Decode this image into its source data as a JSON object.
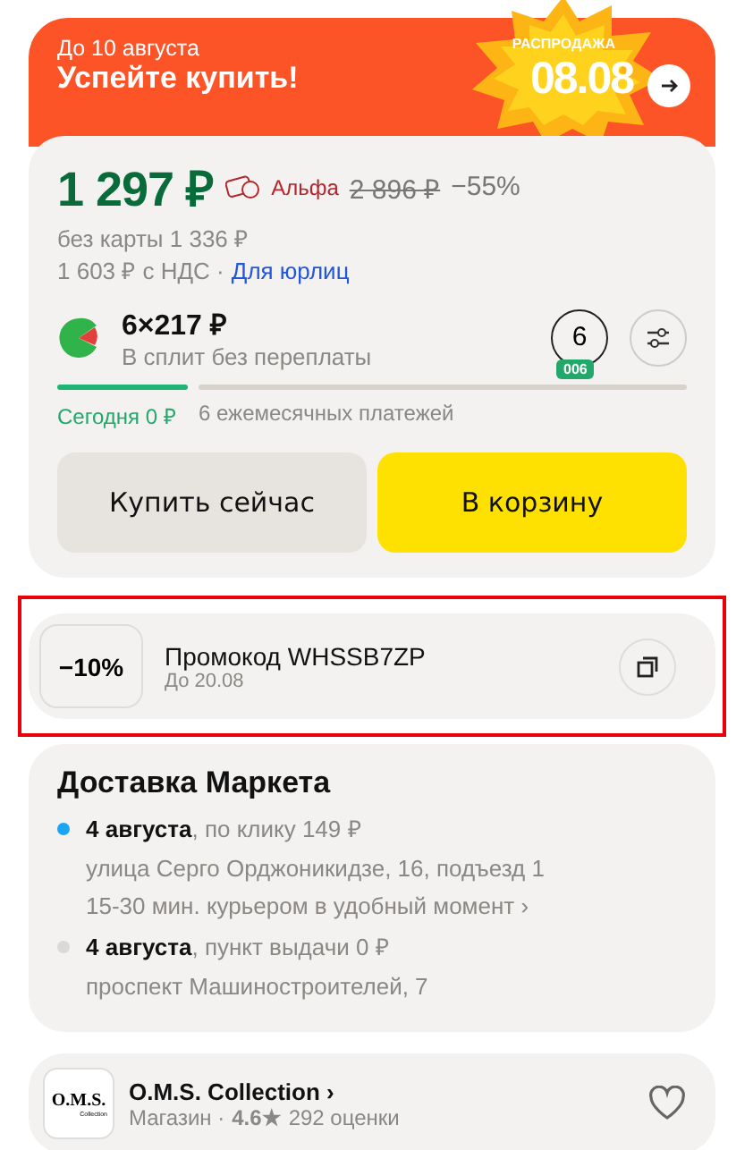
{
  "banner": {
    "subtitle": "До 10 августа",
    "title": "Успейте купить!",
    "sale_label": "РАСПРОДАЖА",
    "sale_date": "08.08"
  },
  "price": {
    "current": "1 297 ₽",
    "bank": "Альфа",
    "old": "2 896 ₽",
    "discount": "−55%",
    "without_card": "без карты 1 336 ₽",
    "vat": "1 603 ₽ с НДС ·",
    "business_link": "Для юрлиц"
  },
  "split": {
    "amount": "6×217 ₽",
    "caption": "В сплит без переплаты",
    "months": "6",
    "months_badge": "006",
    "today": "Сегодня 0 ₽",
    "rest": "6 ежемесячных платежей"
  },
  "buttons": [
    {
      "label": "Купить сейчас",
      "kind": "secondary"
    },
    {
      "label": "В корзину",
      "kind": "primary"
    }
  ],
  "promo": {
    "discount": "−10%",
    "title": "Промокод WHSSB7ZP",
    "until": "До 20.08"
  },
  "delivery": {
    "title": "Доставка Маркета",
    "options": [
      {
        "summary": "**4 августа**, по клику 149 ₽",
        "color": "#1ba6f5",
        "lines": [
          "улица Серго Орджоникидзе, 16, подъезд 1",
          "15-30 мин. курьером в удобный момент ›"
        ]
      },
      {
        "summary": "**4 августа**, пункт выдачи  0 ₽",
        "color": "#d9d9d9",
        "lines": [
          "проспект Машиностроителей, 7"
        ]
      }
    ]
  },
  "shop": {
    "logo_text": "O.M.S.",
    "logo_subtext": "Collection",
    "name": "O.M.S. Collection ›",
    "type": "Магазин ·",
    "rating": "4.6★",
    "reviews": "292 оценки"
  }
}
